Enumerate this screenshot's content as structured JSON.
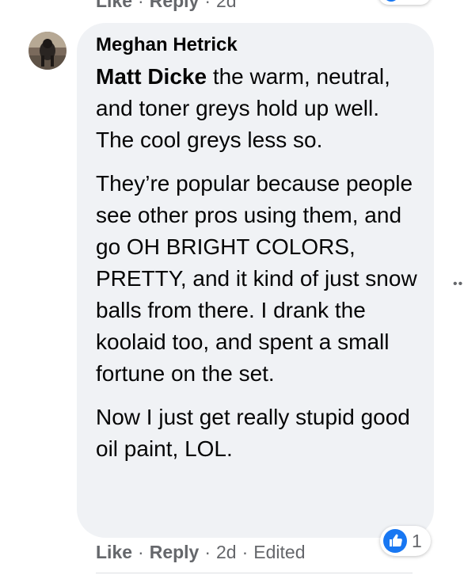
{
  "previous_comment": {
    "like_label": "Like",
    "reply_label": "Reply",
    "timestamp": "2d",
    "separator": "·"
  },
  "comment": {
    "author": "Meghan Hetrick",
    "mention": "Matt Dicke",
    "paragraph1_rest": " the warm, neutral, and toner greys hold up well. The cool greys less so.",
    "paragraph2": "They’re popular because people see other pros using them, and go OH BRIGHT COLORS, PRETTY, and it kind of just snow balls from there. I drank the koolaid too, and spent a small fortune on the set.",
    "paragraph3": "Now I just get really stupid good oil paint, LOL.",
    "reaction_count": "1",
    "reaction_icon": "like-thumb-icon",
    "like_label": "Like",
    "reply_label": "Reply",
    "timestamp": "2d",
    "edited_label": "Edited",
    "separator": "·",
    "more_icon": "more-dots-icon"
  },
  "colors": {
    "bubble": "#f0f2f5",
    "text": "#050505",
    "meta": "#65676b",
    "like_blue": "#1877f2"
  }
}
